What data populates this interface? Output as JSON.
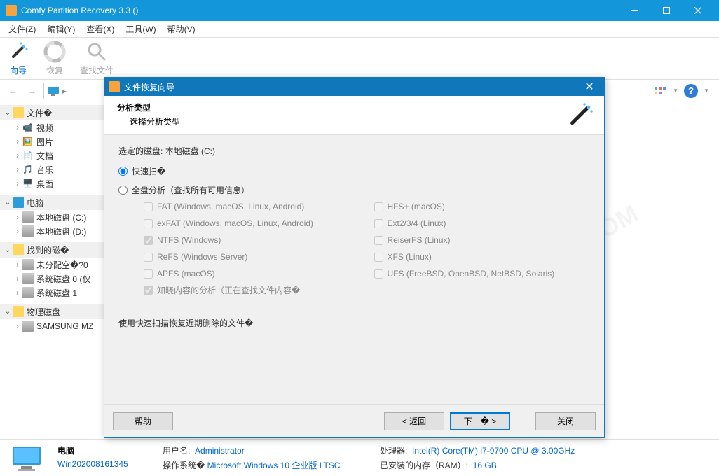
{
  "window": {
    "title": "Comfy Partition Recovery 3.3 ()"
  },
  "menu": {
    "file": "文件(Z)",
    "edit": "编辑(Y)",
    "view": "查看(X)",
    "tools": "工具(W)",
    "help": "帮助(V)"
  },
  "toolbar": {
    "wizard": "向导",
    "recover": "恢复",
    "find": "查找文件"
  },
  "tree": {
    "files_header": "文件�",
    "files": [
      "视频",
      "图片",
      "文档",
      "音乐",
      "桌面"
    ],
    "computer_header": "电脑",
    "drives": [
      "本地磁盘 (C:)",
      "本地磁盘 (D:)"
    ],
    "found_header": "找到的磁�",
    "found": [
      "未分配空�?0",
      "系统磁盘 0 (仅",
      "系统磁盘 1"
    ],
    "physical_header": "物理磁盘",
    "physical": [
      "SAMSUNG MZ"
    ]
  },
  "dialog": {
    "title": "文件恢复向导",
    "h1": "分析类型",
    "h2": "选择分析类型",
    "selected_disk_label": "选定的磁盘:",
    "selected_disk_value": "本地磁盘 (C:)",
    "opt_fast": "快速扫�",
    "opt_full": "全盘分析（查找所有可用信息）",
    "fs": {
      "fat": "FAT (Windows, macOS, Linux, Android)",
      "exfat": "exFAT (Windows, macOS, Linux, Android)",
      "ntfs": "NTFS (Windows)",
      "refs": "ReFS (Windows Server)",
      "apfs": "APFS (macOS)",
      "hfs": "HFS+ (macOS)",
      "ext": "Ext2/3/4 (Linux)",
      "reiser": "ReiserFS (Linux)",
      "xfs": "XFS (Linux)",
      "ufs": "UFS (FreeBSD, OpenBSD, NetBSD, Solaris)"
    },
    "content_aware": "知晓内容的分析（正在查找文件内容�",
    "hint": "使用快速扫描恢复近期删除的文件�",
    "btn_help": "帮助",
    "btn_back": "< 返回",
    "btn_next": "下一� >",
    "btn_close": "关闭"
  },
  "status": {
    "computer": "电脑",
    "hostname": "Win202008161345",
    "user_label": "用户名:",
    "user": "Administrator",
    "os_label": "操作系统�",
    "os": "Microsoft Windows 10 企业版 LTSC",
    "cpu_label": "处理器:",
    "cpu": "Intel(R) Core(TM) i7-9700 CPU @ 3.00GHz",
    "ram_label": "已安装的内存（RAM）:",
    "ram": "16 GB"
  }
}
